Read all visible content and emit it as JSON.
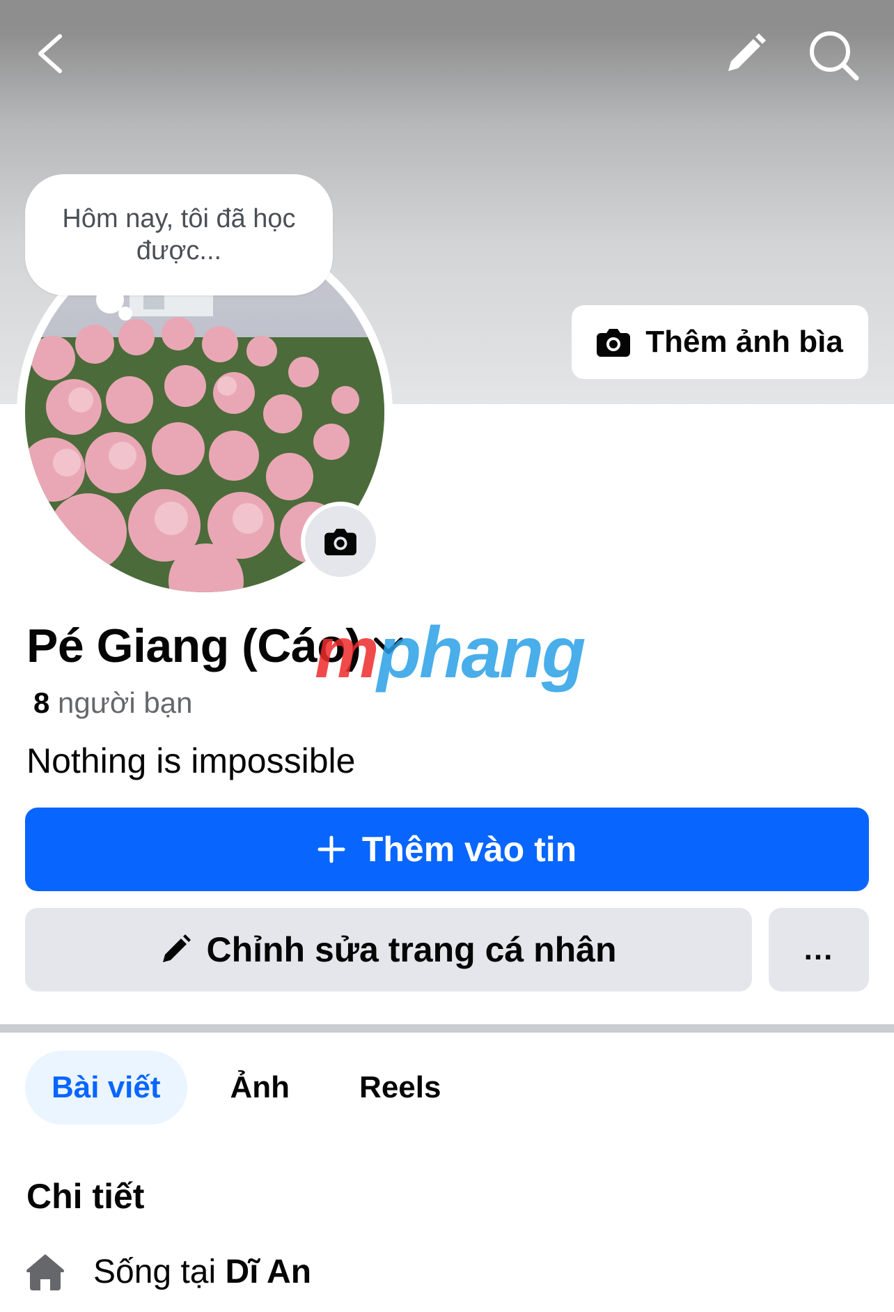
{
  "topbar": {
    "back_icon": "chevron-left-icon",
    "edit_icon": "pencil-icon",
    "search_icon": "search-icon"
  },
  "cover": {
    "add_cover_label": "Thêm ảnh bìa",
    "add_cover_icon": "camera-icon"
  },
  "note": {
    "text": "Hôm nay, tôi đã học được..."
  },
  "avatar": {
    "description_icon": "camera-icon"
  },
  "profile": {
    "name": "Pé Giang (Cáo)",
    "friends_count": "8",
    "friends_label": "người bạn",
    "bio": "Nothing is impossible"
  },
  "watermark": {
    "part1": "m",
    "part2": "phang"
  },
  "actions": {
    "add_to_story": "Thêm vào tin",
    "edit_profile": "Chỉnh sửa trang cá nhân",
    "more": "..."
  },
  "tabs": [
    {
      "label": "Bài viết",
      "active": true
    },
    {
      "label": "Ảnh",
      "active": false
    },
    {
      "label": "Reels",
      "active": false
    }
  ],
  "details": {
    "title": "Chi tiết",
    "lives_in_prefix": "Sống tại",
    "lives_in_place": "Dĩ An"
  },
  "colors": {
    "primary": "#0866ff",
    "secondary_bg": "#e4e6eb",
    "active_tab_bg": "#ebf5ff"
  }
}
